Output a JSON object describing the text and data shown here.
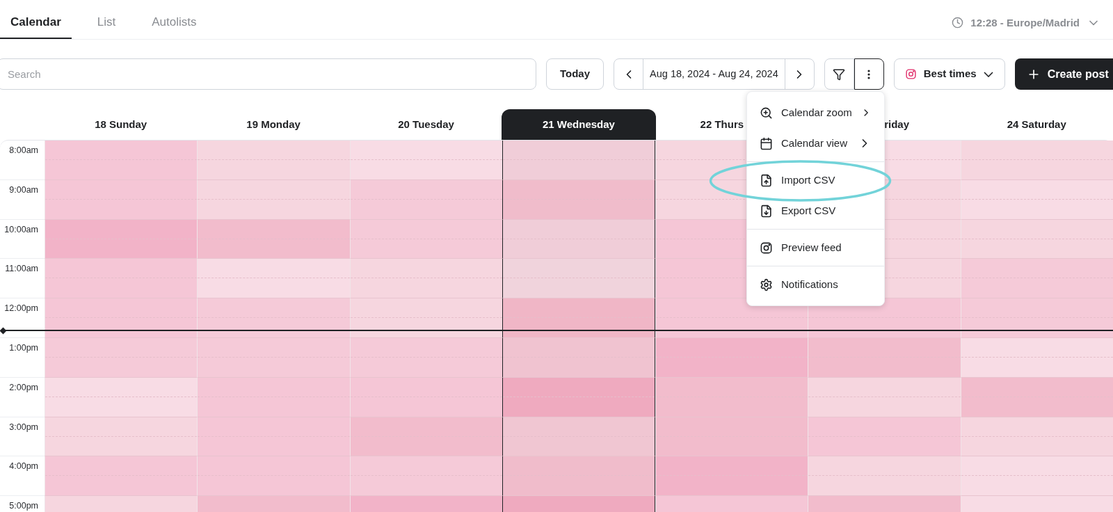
{
  "tabs": [
    {
      "label": "Calendar",
      "selected": true
    },
    {
      "label": "List",
      "selected": false
    },
    {
      "label": "Autolists",
      "selected": false
    }
  ],
  "timezone": {
    "label": "12:28 - Europe/Madrid"
  },
  "toolbar": {
    "search": {
      "placeholder": "Search"
    },
    "today": "Today",
    "date_range": "Aug 18, 2024 - Aug 24, 2024",
    "best_times": "Best times",
    "create_post": "Create post"
  },
  "menu": {
    "open": true,
    "groups": [
      [
        {
          "label": "Calendar zoom",
          "kind": "submenu",
          "highlighted": false
        },
        {
          "label": "Calendar view",
          "kind": "submenu",
          "highlighted": false
        }
      ],
      [
        {
          "label": "Import CSV",
          "kind": "action",
          "highlighted": true
        },
        {
          "label": "Export CSV",
          "kind": "action",
          "highlighted": false
        }
      ],
      [
        {
          "label": "Preview feed",
          "kind": "action",
          "highlighted": false
        }
      ],
      [
        {
          "label": "Notifications",
          "kind": "action",
          "highlighted": false
        }
      ]
    ]
  },
  "days": [
    {
      "label": "18 Sunday",
      "selected": false
    },
    {
      "label": "19 Monday",
      "selected": false
    },
    {
      "label": "20 Tuesday",
      "selected": false
    },
    {
      "label": "21 Wednesday",
      "selected": true
    },
    {
      "label": "22 Thurs",
      "selected": false
    },
    {
      "label": "riday",
      "selected": false
    },
    {
      "label": "24 Saturday",
      "selected": false
    }
  ],
  "rows": [
    {
      "time": "8:00am",
      "cells": [
        {
          "color": "#f5c6d6"
        },
        {
          "color": "#f6d6df"
        },
        {
          "color": "#f8dce5"
        },
        {
          "color": "#f0cdd8"
        },
        {
          "color": "#f6d6df"
        },
        {
          "color": "#f8dce5"
        },
        {
          "color": "#f6d6df"
        }
      ]
    },
    {
      "time": "9:00am",
      "cells": [
        {
          "color": "#f5c6d6"
        },
        {
          "color": "#f6d6df"
        },
        {
          "color": "#f5cad8"
        },
        {
          "color": "#f0bccb"
        },
        {
          "color": "#f6d6df"
        },
        {
          "color": "#f6d6df"
        },
        {
          "color": "#f8dce5"
        }
      ]
    },
    {
      "time": "10:00am",
      "cells": [
        {
          "color": "#f2b3c8"
        },
        {
          "color": "#f2bccc"
        },
        {
          "color": "#f5cad8"
        },
        {
          "color": "#f0cdd8"
        },
        {
          "color": "#f5c6d6"
        },
        {
          "color": "#f6d6df"
        },
        {
          "color": "#f6d6df"
        }
      ]
    },
    {
      "time": "11:00am",
      "cells": [
        {
          "color": "#f5c6d6"
        },
        {
          "color": "#f8dce5"
        },
        {
          "color": "#f6d6df"
        },
        {
          "color": "#f0d3dc"
        },
        {
          "color": "#f5c6d6"
        },
        {
          "color": "#f6d6df"
        },
        {
          "color": "#f5cad8"
        }
      ]
    },
    {
      "time": "12:00pm",
      "cells": [
        {
          "color": "#f5c6d6"
        },
        {
          "color": "#f5cad8"
        },
        {
          "color": "#f6d6df"
        },
        {
          "color": "#f0b6c6"
        },
        {
          "color": "#f5c6d6"
        },
        {
          "color": "#f5c6d6"
        },
        {
          "color": "#f5cad8"
        }
      ]
    },
    {
      "time": "1:00pm",
      "cells": [
        {
          "color": "#f5cad8"
        },
        {
          "color": "#f5cad8"
        },
        {
          "color": "#f5cad8"
        },
        {
          "color": "#f0c3d0"
        },
        {
          "color": "#f2b3c8"
        },
        {
          "color": "#f2bccc"
        },
        {
          "color": "#f8dce5"
        }
      ]
    },
    {
      "time": "2:00pm",
      "cells": [
        {
          "color": "#f8dce5"
        },
        {
          "color": "#f5c6d6"
        },
        {
          "color": "#f5c6d6"
        },
        {
          "color": "#efaabf"
        },
        {
          "color": "#f2bccc"
        },
        {
          "color": "#f6d6df"
        },
        {
          "color": "#f2bccc"
        }
      ]
    },
    {
      "time": "3:00pm",
      "cells": [
        {
          "color": "#f6d6df"
        },
        {
          "color": "#f5c6d6"
        },
        {
          "color": "#f2bccc"
        },
        {
          "color": "#f0c6d2"
        },
        {
          "color": "#f2bccc"
        },
        {
          "color": "#f5c6d6"
        },
        {
          "color": "#f6d6df"
        }
      ]
    },
    {
      "time": "4:00pm",
      "cells": [
        {
          "color": "#f5c6d6"
        },
        {
          "color": "#f5c6d6"
        },
        {
          "color": "#f5cad8"
        },
        {
          "color": "#f0bccb"
        },
        {
          "color": "#f2b3c8"
        },
        {
          "color": "#f6d6df"
        },
        {
          "color": "#f8dce5"
        }
      ]
    },
    {
      "time": "5:00pm",
      "cells": [
        {
          "color": "#f6d6df"
        },
        {
          "color": "#f2bccc"
        },
        {
          "color": "#f2b3c8"
        },
        {
          "color": "#efaabf"
        },
        {
          "color": "#f5c6d6"
        },
        {
          "color": "#f2bccc"
        },
        {
          "color": "#f8dce5"
        }
      ]
    }
  ]
}
